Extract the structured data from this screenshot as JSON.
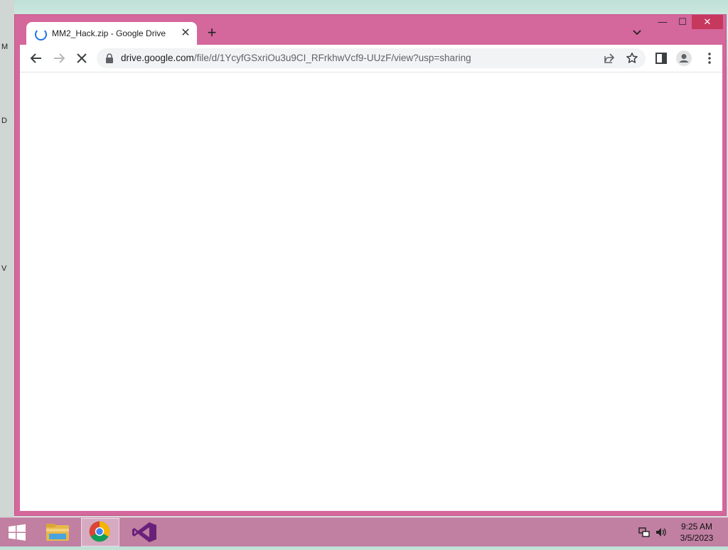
{
  "desktop": {
    "side_letters": [
      "M",
      "D",
      "V"
    ]
  },
  "browser": {
    "tab": {
      "title": "MM2_Hack.zip - Google Drive",
      "close_glyph": "✕"
    },
    "new_tab_glyph": "+",
    "window_controls": {
      "minimize": "—",
      "maximize": "☐",
      "close": "✕"
    },
    "address": {
      "host": "drive.google.com",
      "path": "/file/d/1YcyfGSxriOu3u9CI_RFrkhwVcf9-UUzF/view?usp=sharing"
    },
    "loading": true
  },
  "taskbar": {
    "apps": [
      "windows-start",
      "file-explorer",
      "google-chrome",
      "visual-studio"
    ],
    "clock": {
      "time": "9:25 AM",
      "date": "3/5/2023"
    }
  },
  "colors": {
    "window_frame": "#d4679c",
    "taskbar": "#c17fa2",
    "spinner": "#1a73e8",
    "close_button": "#c7385e"
  }
}
